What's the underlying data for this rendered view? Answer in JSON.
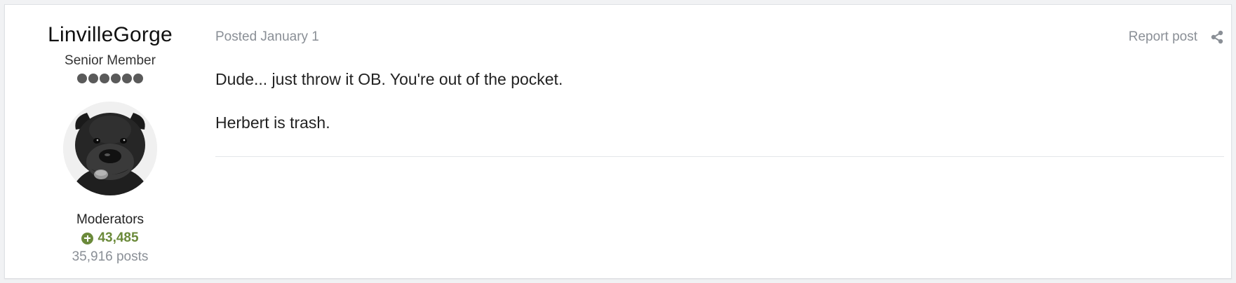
{
  "author": {
    "name": "LinvilleGorge",
    "title": "Senior Member",
    "pip_count": 6,
    "group": "Moderators",
    "reputation": "43,485",
    "posts": "35,916 posts",
    "avatar_icon": "dog-avatar-icon"
  },
  "post": {
    "posted": "Posted January 1",
    "report_label": "Report post",
    "share_icon": "share-icon",
    "paragraphs": [
      "Dude... just throw it OB. You're out of the pocket.",
      "Herbert is trash."
    ]
  },
  "colors": {
    "reputation": "#6b8a3a",
    "muted": "#8a8f96",
    "pip": "#5a5a5a"
  }
}
